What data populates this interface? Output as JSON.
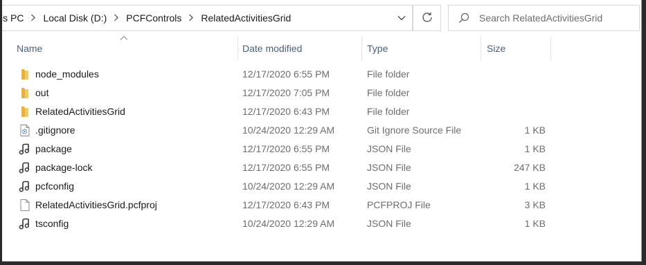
{
  "address_bar": {
    "crumbs": [
      "is PC",
      "Local Disk (D:)",
      "PCFControls",
      "RelatedActivitiesGrid"
    ],
    "search_placeholder": "Search RelatedActivitiesGrid"
  },
  "columns": {
    "name": "Name",
    "date_modified": "Date modified",
    "type": "Type",
    "size": "Size"
  },
  "files": [
    {
      "name": "node_modules",
      "date": "12/17/2020 6:55 PM",
      "type": "File folder",
      "size": "",
      "icon": "folder-icon"
    },
    {
      "name": "out",
      "date": "12/17/2020 7:05 PM",
      "type": "File folder",
      "size": "",
      "icon": "folder-icon"
    },
    {
      "name": "RelatedActivitiesGrid",
      "date": "12/17/2020 6:43 PM",
      "type": "File folder",
      "size": "",
      "icon": "folder-icon"
    },
    {
      "name": ".gitignore",
      "date": "10/24/2020 12:29 AM",
      "type": "Git Ignore Source File",
      "size": "1 KB",
      "icon": "settings-file-icon"
    },
    {
      "name": "package",
      "date": "12/17/2020 6:55 PM",
      "type": "JSON File",
      "size": "1 KB",
      "icon": "json-file-icon"
    },
    {
      "name": "package-lock",
      "date": "12/17/2020 6:55 PM",
      "type": "JSON File",
      "size": "247 KB",
      "icon": "json-file-icon"
    },
    {
      "name": "pcfconfig",
      "date": "10/24/2020 12:29 AM",
      "type": "JSON File",
      "size": "1 KB",
      "icon": "json-file-icon"
    },
    {
      "name": "RelatedActivitiesGrid.pcfproj",
      "date": "12/17/2020 6:43 PM",
      "type": "PCFPROJ File",
      "size": "3 KB",
      "icon": "blank-file-icon"
    },
    {
      "name": "tsconfig",
      "date": "10/24/2020 12:29 AM",
      "type": "JSON File",
      "size": "1 KB",
      "icon": "json-file-icon"
    }
  ],
  "colors": {
    "folder": "#f4c95d",
    "header_text": "#4c607a",
    "secondary_text": "#6d6d6d"
  }
}
